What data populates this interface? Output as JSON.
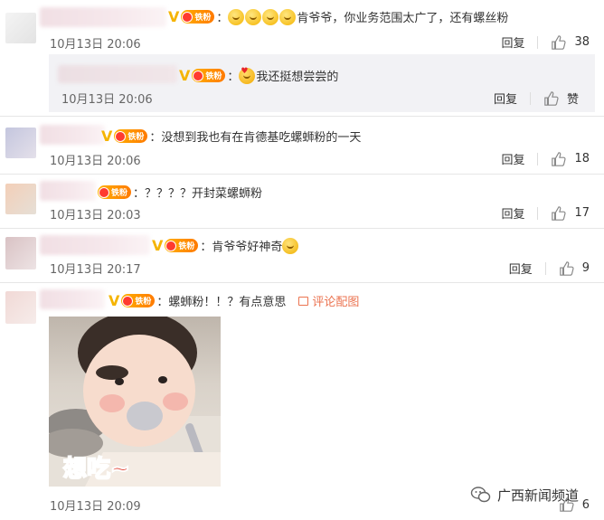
{
  "comments": [
    {
      "body": "：",
      "trail_text": "肯爷爷，你业务范围太广了，还有螺丝粉",
      "emoji_count": 4,
      "timestamp": "10月13日 20:06",
      "reply_label": "回复",
      "likes": "38"
    },
    {
      "body": "：",
      "trail_text": "我还挺想尝尝的",
      "timestamp": "10月13日 20:06",
      "reply_label": "回复",
      "likes": "赞"
    },
    {
      "body": "：没想到我也有在肯德基吃螺蛳粉的一天",
      "timestamp": "10月13日 20:06",
      "reply_label": "回复",
      "likes": "18"
    },
    {
      "body": "：？？？？开封菜螺蛳粉",
      "timestamp": "10月13日 20:03",
      "reply_label": "回复",
      "likes": "17"
    },
    {
      "body": "：肯爷爷好神奇",
      "timestamp": "10月13日 20:17",
      "reply_label": "回复",
      "likes": "9"
    },
    {
      "body": "：螺蛳粉！！？有点意思",
      "pic_link": "评论配图",
      "timestamp": "10月13日 20:09",
      "reply_label": "回复",
      "likes": "6"
    }
  ],
  "badge": {
    "v": "V",
    "fan_label": "铁粉"
  },
  "photo": {
    "caption": "想吃~"
  },
  "watermark": {
    "text": "广西新闻频道"
  },
  "colors": {
    "accent": "#eb7350",
    "vip": "#f5b400",
    "fan_badge": "#ff8a00"
  }
}
